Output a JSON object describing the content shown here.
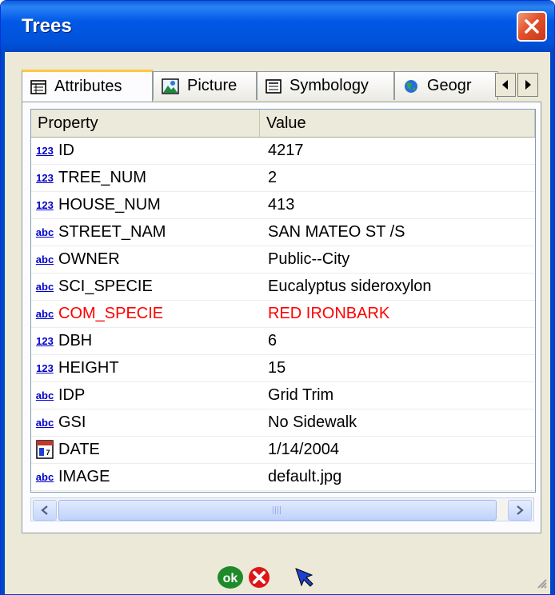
{
  "window": {
    "title": "Trees"
  },
  "tabs": [
    {
      "label": "Attributes",
      "icon": "grid-icon"
    },
    {
      "label": "Picture",
      "icon": "picture-icon"
    },
    {
      "label": "Symbology",
      "icon": "list-icon"
    },
    {
      "label": "Geogr",
      "icon": "globe-icon"
    }
  ],
  "grid": {
    "headers": [
      "Property",
      "Value"
    ],
    "rows": [
      {
        "type": "123",
        "property": "ID",
        "value": "4217"
      },
      {
        "type": "123",
        "property": "TREE_NUM",
        "value": "2"
      },
      {
        "type": "123",
        "property": "HOUSE_NUM",
        "value": "413"
      },
      {
        "type": "abc",
        "property": "STREET_NAM",
        "value": "SAN MATEO ST /S"
      },
      {
        "type": "abc",
        "property": "OWNER",
        "value": "Public--City"
      },
      {
        "type": "abc",
        "property": "SCI_SPECIE",
        "value": "Eucalyptus sideroxylon"
      },
      {
        "type": "abc",
        "property": "COM_SPECIE",
        "value": "RED IRONBARK",
        "highlight": true
      },
      {
        "type": "123",
        "property": "DBH",
        "value": "6"
      },
      {
        "type": "123",
        "property": "HEIGHT",
        "value": "15"
      },
      {
        "type": "abc",
        "property": "IDP",
        "value": "Grid Trim"
      },
      {
        "type": "abc",
        "property": "GSI",
        "value": "No Sidewalk"
      },
      {
        "type": "date",
        "property": "DATE",
        "value": "1/14/2004"
      },
      {
        "type": "abc",
        "property": "IMAGE",
        "value": "default.jpg"
      }
    ]
  },
  "footer": {
    "ok_label": "ok"
  },
  "colors": {
    "titlebar": "#0058e6",
    "highlight": "#ff0000",
    "type_icon": "#0000cc"
  }
}
